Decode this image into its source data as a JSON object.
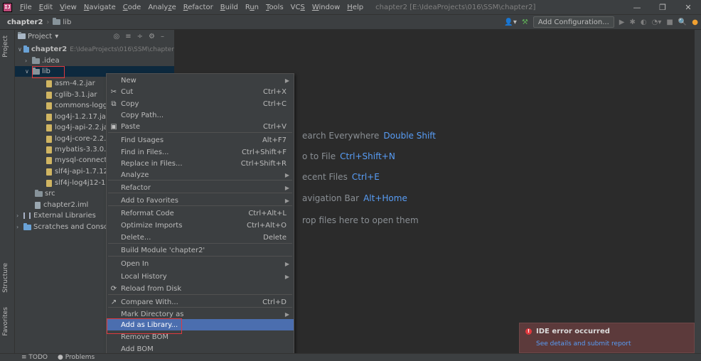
{
  "menubar": {
    "items": [
      {
        "pre": "",
        "u": "F",
        "post": "ile"
      },
      {
        "pre": "",
        "u": "E",
        "post": "dit"
      },
      {
        "pre": "",
        "u": "V",
        "post": "iew"
      },
      {
        "pre": "",
        "u": "N",
        "post": "avigate"
      },
      {
        "pre": "",
        "u": "C",
        "post": "ode"
      },
      {
        "pre": "Analy",
        "u": "z",
        "post": "e"
      },
      {
        "pre": "",
        "u": "R",
        "post": "efactor"
      },
      {
        "pre": "",
        "u": "B",
        "post": "uild"
      },
      {
        "pre": "R",
        "u": "u",
        "post": "n"
      },
      {
        "pre": "",
        "u": "T",
        "post": "ools"
      },
      {
        "pre": "VC",
        "u": "S",
        "post": ""
      },
      {
        "pre": "",
        "u": "W",
        "post": "indow"
      },
      {
        "pre": "",
        "u": "H",
        "post": "elp"
      }
    ],
    "window_title": "chapter2 [E:\\IdeaProjects\\016\\SSM\\chapter2]",
    "minimize": "—",
    "maximize": "❐",
    "close": "✕"
  },
  "breadcrumb": {
    "project": "chapter2",
    "folder": "lib"
  },
  "toolbar": {
    "add_configuration": "Add Configuration..."
  },
  "sidebar": {
    "project_label": "Project",
    "structure_label": "Structure",
    "favorites_label": "Favorites"
  },
  "project_panel": {
    "title": "Project",
    "tree": [
      {
        "label": "chapter2",
        "extra": "E:\\IdeaProjects\\016\\SSM\\chapter",
        "type": "module"
      },
      {
        "label": ".idea",
        "type": "folder"
      },
      {
        "label": "lib",
        "type": "folder"
      },
      {
        "label": "asm-4.2.jar",
        "type": "jar"
      },
      {
        "label": "cglib-3.1.jar",
        "type": "jar"
      },
      {
        "label": "commons-logg",
        "type": "jar"
      },
      {
        "label": "log4j-1.2.17.jar",
        "type": "jar"
      },
      {
        "label": "log4j-api-2.2.ja",
        "type": "jar"
      },
      {
        "label": "log4j-core-2.2.j",
        "type": "jar"
      },
      {
        "label": "mybatis-3.3.0.ja",
        "type": "jar"
      },
      {
        "label": "mysql-connecto",
        "type": "jar"
      },
      {
        "label": "slf4j-api-1.7.12.",
        "type": "jar"
      },
      {
        "label": "slf4j-log4j12-1.",
        "type": "jar"
      },
      {
        "label": "src",
        "type": "folder"
      },
      {
        "label": "chapter2.iml",
        "type": "file"
      },
      {
        "label": "External Libraries",
        "type": "lib"
      },
      {
        "label": "Scratches and Console",
        "type": "scratch"
      }
    ]
  },
  "editor_hints": [
    {
      "text": "earch Everywhere",
      "key": "Double Shift"
    },
    {
      "text": "o to File",
      "key": "Ctrl+Shift+N"
    },
    {
      "text": "ecent Files",
      "key": "Ctrl+E"
    },
    {
      "text": "avigation Bar",
      "key": "Alt+Home"
    },
    {
      "text": "rop files here to open them",
      "key": ""
    }
  ],
  "context_menu": {
    "items": [
      {
        "label": "New",
        "shortcut": "",
        "icon": "",
        "submenu": true
      },
      {
        "label": "Cut",
        "shortcut": "Ctrl+X",
        "icon": "✂",
        "submenu": false
      },
      {
        "label": "Copy",
        "shortcut": "Ctrl+C",
        "icon": "⧉",
        "submenu": false
      },
      {
        "label": "Copy Path...",
        "shortcut": "",
        "icon": "",
        "submenu": false
      },
      {
        "label": "Paste",
        "shortcut": "Ctrl+V",
        "icon": "▣",
        "submenu": false
      },
      {
        "label": "Find Usages",
        "shortcut": "Alt+F7",
        "icon": "",
        "submenu": false
      },
      {
        "label": "Find in Files...",
        "shortcut": "Ctrl+Shift+F",
        "icon": "",
        "submenu": false
      },
      {
        "label": "Replace in Files...",
        "shortcut": "Ctrl+Shift+R",
        "icon": "",
        "submenu": false
      },
      {
        "label": "Analyze",
        "shortcut": "",
        "icon": "",
        "submenu": true
      },
      {
        "label": "Refactor",
        "shortcut": "",
        "icon": "",
        "submenu": true
      },
      {
        "label": "Add to Favorites",
        "shortcut": "",
        "icon": "",
        "submenu": true
      },
      {
        "label": "Reformat Code",
        "shortcut": "Ctrl+Alt+L",
        "icon": "",
        "submenu": false
      },
      {
        "label": "Optimize Imports",
        "shortcut": "Ctrl+Alt+O",
        "icon": "",
        "submenu": false
      },
      {
        "label": "Delete...",
        "shortcut": "Delete",
        "icon": "",
        "submenu": false
      },
      {
        "label": "Build Module 'chapter2'",
        "shortcut": "",
        "icon": "",
        "submenu": false
      },
      {
        "label": "Open In",
        "shortcut": "",
        "icon": "",
        "submenu": true
      },
      {
        "label": "Local History",
        "shortcut": "",
        "icon": "",
        "submenu": true
      },
      {
        "label": "Reload from Disk",
        "shortcut": "",
        "icon": "⟳",
        "submenu": false
      },
      {
        "label": "Compare With...",
        "shortcut": "Ctrl+D",
        "icon": "↗",
        "submenu": false
      },
      {
        "label": "Mark Directory as",
        "shortcut": "",
        "icon": "",
        "submenu": true
      },
      {
        "label": "Add as Library...",
        "shortcut": "",
        "icon": "",
        "submenu": false
      },
      {
        "label": "Remove BOM",
        "shortcut": "",
        "icon": "",
        "submenu": false
      },
      {
        "label": "Add BOM",
        "shortcut": "",
        "icon": "",
        "submenu": false
      }
    ]
  },
  "statusbar": {
    "todo": "TODO",
    "problems": "Problems"
  },
  "notification": {
    "title": "IDE error occurred",
    "link": "See details and submit report"
  }
}
